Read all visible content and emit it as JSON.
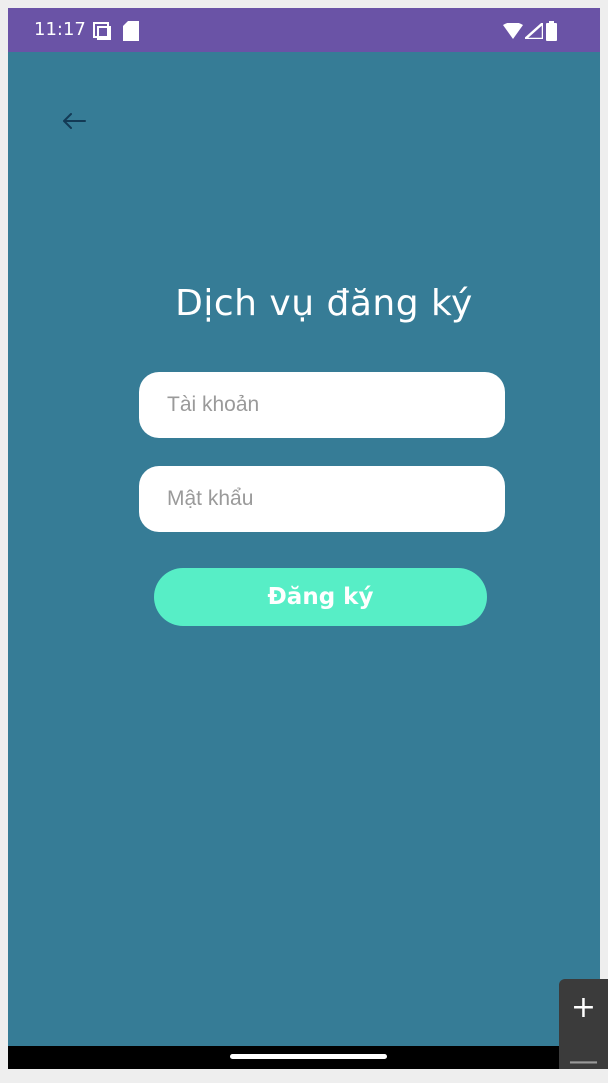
{
  "status_bar": {
    "time": "11:17",
    "icons": [
      "screenshot-icon",
      "sd-card-icon",
      "wifi-icon",
      "signal-icon",
      "battery-icon"
    ]
  },
  "header": {
    "back_icon": "arrow-left-icon"
  },
  "main": {
    "title": "Dịch vụ đăng ký",
    "username_placeholder": "Tài khoản",
    "password_placeholder": "Mật khẩu",
    "register_label": "Đăng ký"
  },
  "zoom_controls": {
    "zoom_in_label": "+",
    "zoom_out_label": "—"
  },
  "colors": {
    "status_bar": "#6a53a6",
    "background": "#367c96",
    "input_background": "#ffffff",
    "button_background": "#57eec6",
    "back_arrow": "#133a55"
  }
}
